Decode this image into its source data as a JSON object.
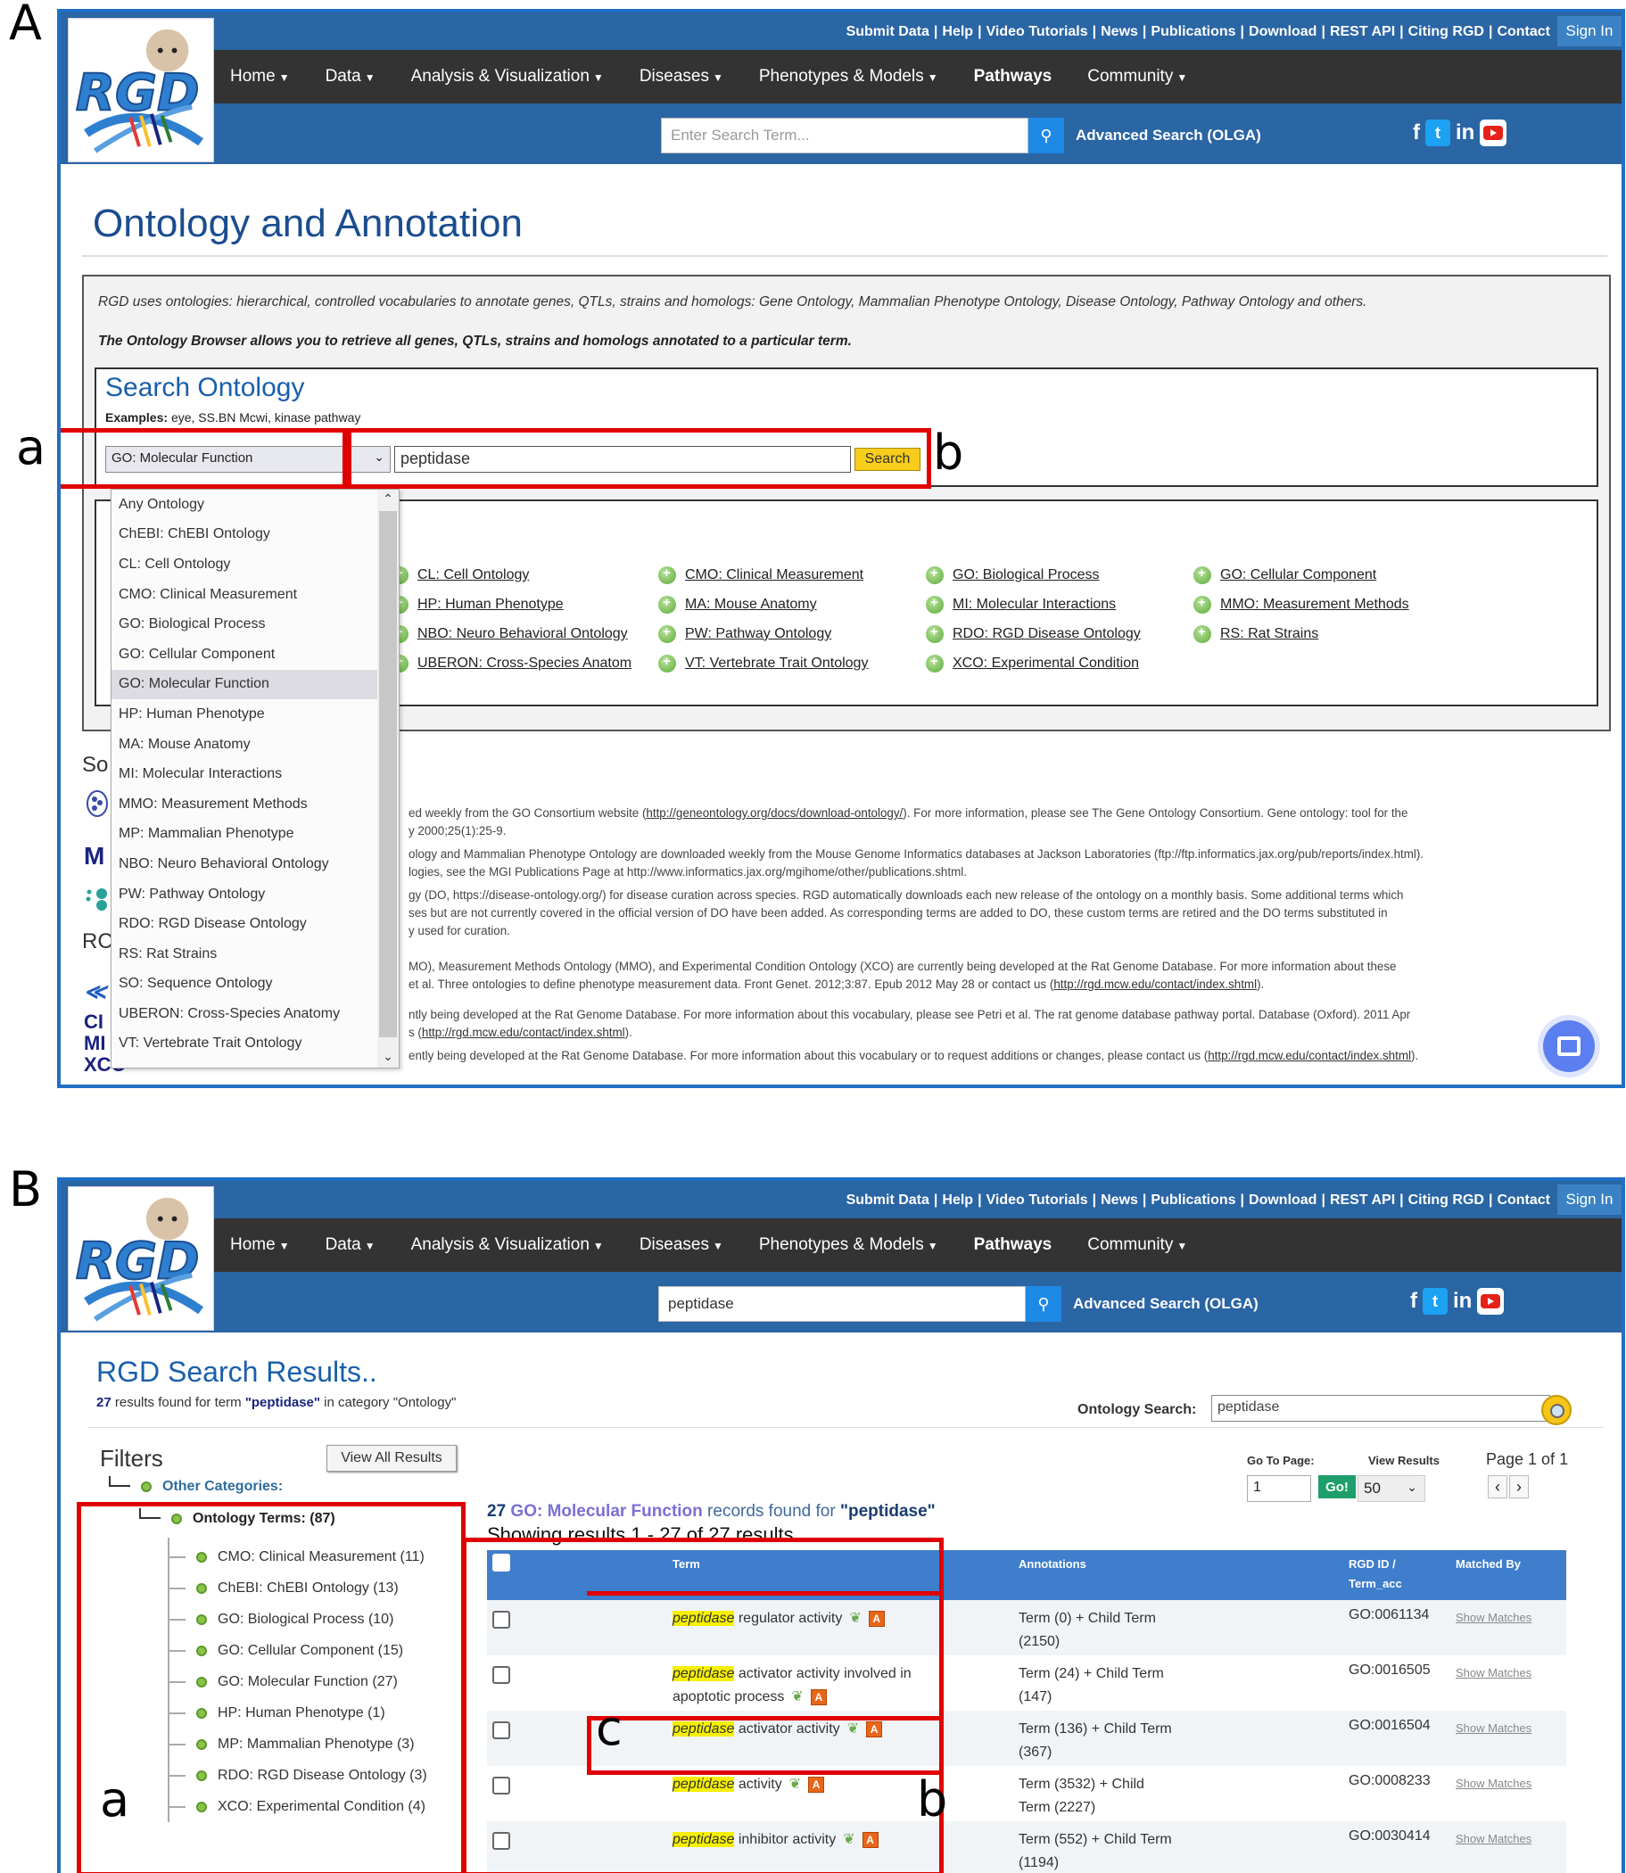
{
  "panel_labels": {
    "A": "A",
    "B": "B"
  },
  "annotations": {
    "a": "a",
    "b": "b",
    "c": "c"
  },
  "header": {
    "top_links": [
      "Submit Data",
      "Help",
      "Video Tutorials",
      "News",
      "Publications",
      "Download",
      "REST API",
      "Citing RGD",
      "Contact"
    ],
    "sign_in": "Sign In",
    "nav": [
      {
        "label": "Home",
        "caret": true
      },
      {
        "label": "Data",
        "caret": true
      },
      {
        "label": "Analysis & Visualization",
        "caret": true
      },
      {
        "label": "Diseases",
        "caret": true
      },
      {
        "label": "Phenotypes & Models",
        "caret": true
      },
      {
        "label": "Pathways",
        "caret": false
      },
      {
        "label": "Community",
        "caret": true
      }
    ],
    "search_placeholder": "Enter Search Term...",
    "advanced_search": "Advanced Search (OLGA)",
    "social": {
      "facebook": "f",
      "twitter": "t",
      "linkedin": "in",
      "youtube": "youtube-icon"
    }
  },
  "panelA": {
    "page_title": "Ontology and Annotation",
    "intro_1": "RGD uses ontologies: hierarchical, controlled vocabularies to annotate genes, QTLs, strains and homologs: Gene Ontology, Mammalian Phenotype Ontology, Disease Ontology, Pathway Ontology and others.",
    "intro_2": "The Ontology Browser allows you to retrieve all genes, QTLs, strains and homologs annotated to a particular term.",
    "search_title": "Search Ontology",
    "examples_label": "Examples:",
    "examples": "eye, SS.BN Mcwi, kinase pathway",
    "selected_ontology": "GO: Molecular Function",
    "search_value": "peptidase",
    "search_button": "Search",
    "dropdown_options": [
      "Any Ontology",
      "ChEBI: ChEBI Ontology",
      "CL: Cell Ontology",
      "CMO: Clinical Measurement",
      "GO: Biological Process",
      "GO: Cellular Component",
      "GO: Molecular Function",
      "HP: Human Phenotype",
      "MA: Mouse Anatomy",
      "MI: Molecular Interactions",
      "MMO: Measurement Methods",
      "MP: Mammalian Phenotype",
      "NBO: Neuro Behavioral Ontology",
      "PW: Pathway Ontology",
      "RDO: RGD Disease Ontology",
      "RS: Rat Strains",
      "SO: Sequence Ontology",
      "UBERON: Cross-Species Anatomy",
      "VT: Vertebrate Trait Ontology"
    ],
    "dropdown_selected_index": 6,
    "browse_links": [
      "CL: Cell Ontology",
      "CMO: Clinical Measurement",
      "GO: Biological Process",
      "GO: Cellular Component",
      "HP: Human Phenotype",
      "MA: Mouse Anatomy",
      "MI: Molecular Interactions",
      "MMO: Measurement Methods",
      "NBO: Neuro Behavioral Ontology",
      "PW: Pathway Ontology",
      "RDO: RGD Disease Ontology",
      "RS: Rat Strains",
      "UBERON: Cross-Species Anatom",
      "VT: Vertebrate Trait Ontology",
      "XCO: Experimental Condition"
    ],
    "sources_heading": "So",
    "rgd_heading": "RC",
    "side_abbrevs": "CI\nMI\nXCO",
    "sources": [
      {
        "pre": "ed weekly from the GO Consortium website (",
        "link": "http://geneontology.org/docs/download-ontology/",
        "post": "). For more information, please see The Gene Ontology Consortium. Gene ontology: tool for the"
      },
      {
        "pre": "y 2000;25(1):25-9.",
        "link": "",
        "post": ""
      },
      {
        "pre": "ology and Mammalian Phenotype Ontology are downloaded weekly from the Mouse Genome Informatics databases at Jackson Laboratories (ftp://ftp.informatics.jax.org/pub/reports/index.html).",
        "link": "",
        "post": ""
      },
      {
        "pre": "logies, see the MGI Publications Page at http://www.informatics.jax.org/mgihome/other/publications.shtml.",
        "link": "",
        "post": ""
      },
      {
        "pre": "gy (DO, https://disease-ontology.org/) for disease curation across species. RGD automatically downloads each new release of the ontology on a monthly basis. Some additional terms which",
        "link": "",
        "post": ""
      },
      {
        "pre": "ses but are not currently covered in the official version of DO have been added. As corresponding terms are added to DO, these custom terms are retired and the DO terms substituted in",
        "link": "",
        "post": ""
      },
      {
        "pre": "y used for curation.",
        "link": "",
        "post": ""
      },
      {
        "pre": "MO), Measurement Methods Ontology (MMO), and Experimental Condition Ontology (XCO) are currently being developed at the Rat Genome Database. For more information about these",
        "link": "",
        "post": ""
      },
      {
        "pre": "et al. Three ontologies to define phenotype measurement data. Front Genet. 2012;3:87. Epub 2012 May 28 or contact us (",
        "link": "http://rgd.mcw.edu/contact/index.shtml",
        "post": ")."
      },
      {
        "pre": "ntly being developed at the Rat Genome Database. For more information about this vocabulary, please see Petri et al. The rat genome database pathway portal. Database (Oxford). 2011 Apr",
        "link": "",
        "post": ""
      },
      {
        "pre": "s (",
        "link": "http://rgd.mcw.edu/contact/index.shtml",
        "post": ")."
      },
      {
        "pre": "ently being developed at the Rat Genome Database. For more information about this vocabulary or to request additions or changes, please contact us (",
        "link": "http://rgd.mcw.edu/contact/index.shtml",
        "post": ")."
      }
    ]
  },
  "panelB": {
    "global_search_value": "peptidase",
    "results_title": "RGD Search Results..",
    "results_count": "27",
    "results_text_1": " results found for term ",
    "results_term": "\"peptidase\"",
    "results_text_2": " in category \"Ontology\"",
    "ontology_search_label": "Ontology Search:",
    "ontology_search_value": "peptidase",
    "filters_title": "Filters",
    "view_all_button": "View All Results",
    "other_categories": "Other Categories:",
    "ontology_terms": "Ontology Terms: (87)",
    "filter_items": [
      "CMO: Clinical Measurement (11)",
      "ChEBI: ChEBI Ontology (13)",
      "GO: Biological Process (10)",
      "GO: Cellular Component (15)",
      "GO: Molecular Function (27)",
      "HP: Human Phenotype (1)",
      "MP: Mammalian Phenotype (3)",
      "RDO: RGD Disease Ontology (3)",
      "XCO: Experimental Condition (4)"
    ],
    "go_to_page_label": "Go To Page:",
    "go_to_page_value": "1",
    "go_button": "Go!",
    "view_results_label": "View Results",
    "view_results_value": "50",
    "page_of": "Page 1 of 1",
    "prev": "‹",
    "next": "›",
    "found_count": "27",
    "found_category": "GO: Molecular Function",
    "found_mid": " records found for ",
    "found_term": "\"peptidase\"",
    "showing": "Showing results 1 - 27 of 27 results",
    "columns": {
      "term": "Term",
      "annotations": "Annotations",
      "rgd_id": "RGD ID /",
      "term_acc": "Term_acc",
      "matched_by": "Matched By"
    },
    "rows": [
      {
        "highlight": "peptidase",
        "rest": " regulator activity",
        "annotations": "Term (0) + Child Term (2150)",
        "id": "GO:0061134",
        "matched": "Show Matches"
      },
      {
        "highlight": "peptidase",
        "rest": " activator activity involved in apoptotic process",
        "annotations": "Term (24) + Child Term (147)",
        "id": "GO:0016505",
        "matched": "Show Matches"
      },
      {
        "highlight": "peptidase",
        "rest": " activator activity",
        "annotations": "Term (136) + Child Term (367)",
        "id": "GO:0016504",
        "matched": "Show Matches"
      },
      {
        "highlight": "peptidase",
        "rest": " activity",
        "annotations": "Term (3532) + Child Term (2227)",
        "id": "GO:0008233",
        "matched": "Show Matches"
      },
      {
        "highlight": "peptidase",
        "rest": " inhibitor activity",
        "annotations": "Term (552) + Child Term (1194)",
        "id": "GO:0030414",
        "matched": "Show Matches"
      }
    ]
  }
}
